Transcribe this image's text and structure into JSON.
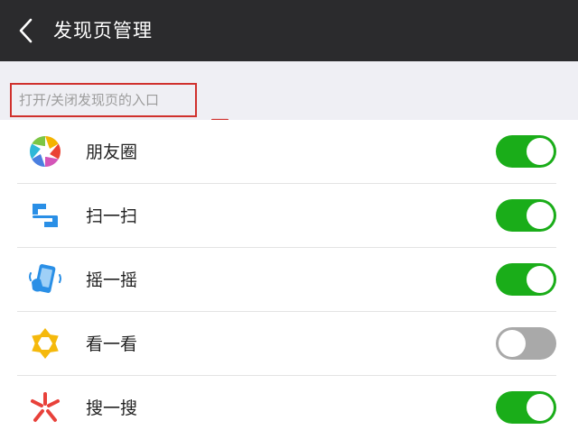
{
  "header": {
    "title": "发现页管理",
    "back_icon": "chevron-left-icon"
  },
  "section": {
    "label": "打开/关闭发现页的入口"
  },
  "items": [
    {
      "label": "朋友圈",
      "icon": "moments-aperture-icon",
      "enabled": true
    },
    {
      "label": "扫一扫",
      "icon": "scan-icon",
      "enabled": true
    },
    {
      "label": "摇一摇",
      "icon": "shake-phone-icon",
      "enabled": true
    },
    {
      "label": "看一看",
      "icon": "top-stories-icon",
      "enabled": false
    },
    {
      "label": "搜一搜",
      "icon": "search-spark-icon",
      "enabled": true
    }
  ],
  "colors": {
    "toggle_on": "#1aad19",
    "toggle_off": "#a9a9a9",
    "annotation": "#d0312d",
    "header_bg": "#2b2b2d"
  }
}
